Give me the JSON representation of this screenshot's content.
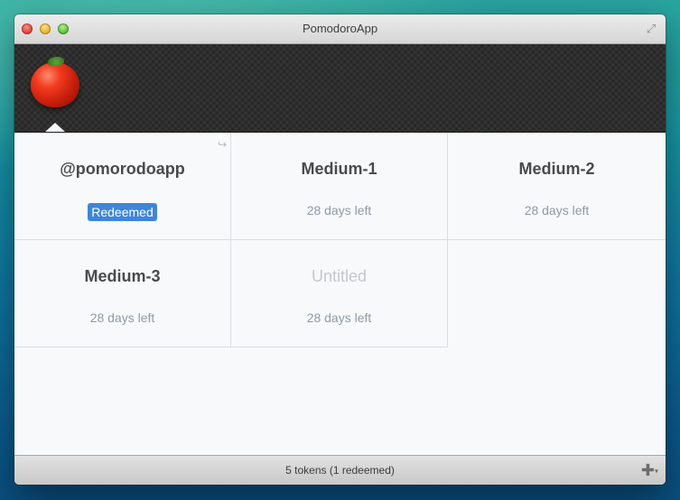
{
  "window": {
    "title": "PomodoroApp"
  },
  "tokens": [
    {
      "name": "@pomorodoapp",
      "status": "Redeemed",
      "redeemed": true
    },
    {
      "name": "Medium-1",
      "status": "28 days left",
      "redeemed": false
    },
    {
      "name": "Medium-2",
      "status": "28 days left",
      "redeemed": false
    },
    {
      "name": "Medium-3",
      "status": "28 days left",
      "redeemed": false
    },
    {
      "name": "Untitled",
      "status": "28 days left",
      "redeemed": false,
      "placeholder": true
    }
  ],
  "footer": {
    "summary": "5 tokens (1 redeemed)"
  },
  "icons": {
    "close": "close-button",
    "minimize": "minimize-button",
    "zoom": "zoom-button",
    "fullscreen": "fullscreen-icon",
    "share": "share-icon",
    "add": "add-icon",
    "app": "tomato-icon"
  },
  "colors": {
    "badge": "#3f86d6",
    "header": "#2e2e2e",
    "status_text": "#8e9aa6"
  }
}
